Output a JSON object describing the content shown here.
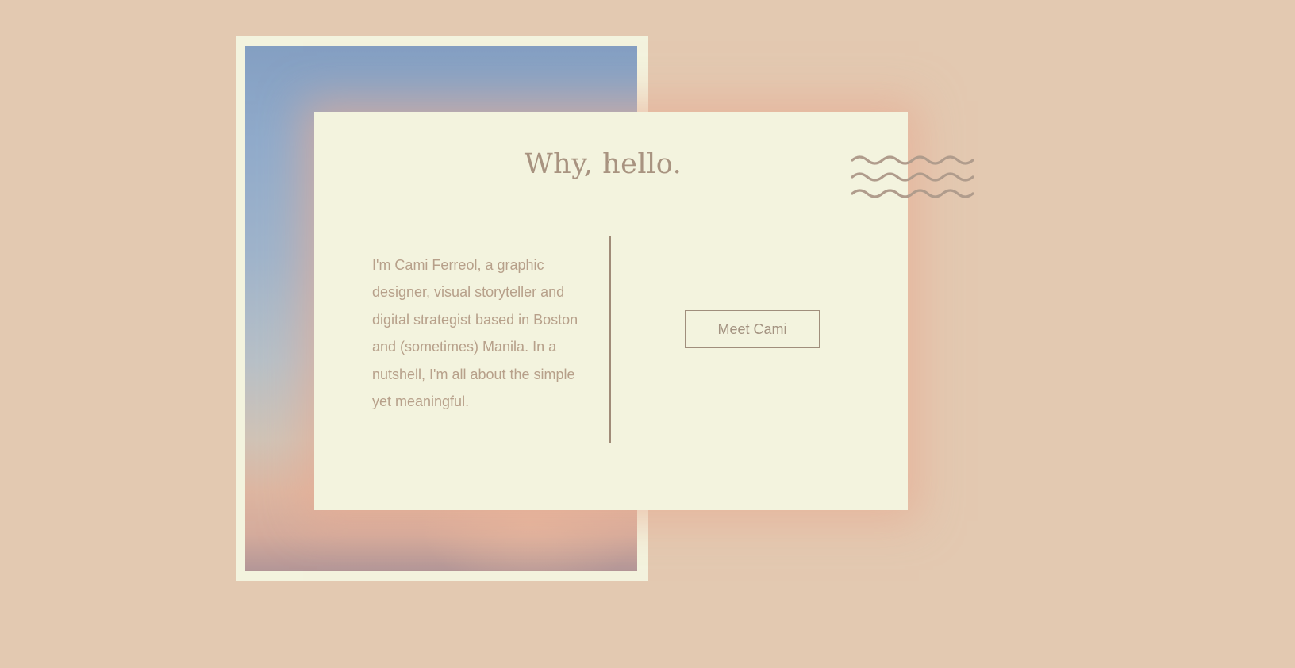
{
  "card": {
    "title": "Why, hello.",
    "body": "I'm Cami Ferreol, a graphic designer, visual storyteller and digital strategist based in Boston and (sometimes) Manila. In a nutshell, I'm all about the simple yet meaningful.",
    "button_label": "Meet Cami"
  },
  "colors": {
    "page_background": "#E3C9B1",
    "card_background": "#F3F3DE",
    "text": "#B7A08A",
    "accent": "#A08B78"
  },
  "icons": {
    "decoration": "postmark-wavy-lines-icon"
  }
}
